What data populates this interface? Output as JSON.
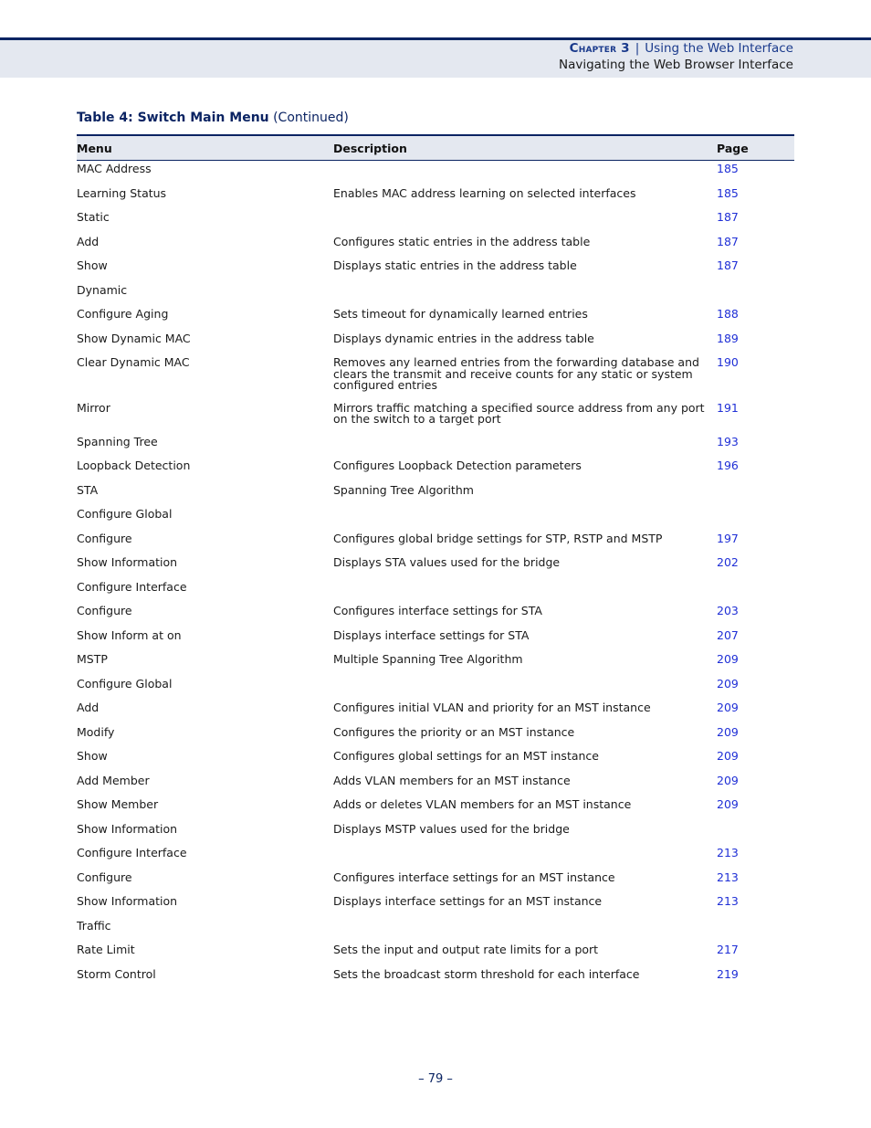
{
  "header": {
    "chapter_label": "Chapter 3",
    "separator": "|",
    "chapter_title": "Using the Web Interface",
    "section_title": "Navigating the Web Browser Interface"
  },
  "table": {
    "caption_bold": "Table 4: Switch Main Menu",
    "caption_suffix": "(Continued)",
    "columns": [
      "Menu",
      "Description",
      "Page"
    ],
    "rows": [
      {
        "level": 0,
        "menu": "MAC Address",
        "description": "",
        "page": "185"
      },
      {
        "level": 1,
        "menu": "Learning Status",
        "description": "Enables MAC address learning on selected interfaces",
        "page": "185"
      },
      {
        "level": 1,
        "menu": "Static",
        "description": "",
        "page": "187"
      },
      {
        "level": 2,
        "menu": "Add",
        "description": "Configures static entries in the address table",
        "page": "187"
      },
      {
        "level": 2,
        "menu": "Show",
        "description": "Displays static entries in the address table",
        "page": "187"
      },
      {
        "level": 1,
        "menu": "Dynamic",
        "description": "",
        "page": ""
      },
      {
        "level": 2,
        "menu": "Configure Aging",
        "description": "Sets timeout for dynamically learned entries",
        "page": "188"
      },
      {
        "level": 2,
        "menu": "Show Dynamic MAC",
        "description": "Displays dynamic entries in the address table",
        "page": "189"
      },
      {
        "level": 2,
        "menu": "Clear Dynamic MAC",
        "description": "Removes any learned entries from the forwarding database and clears the transmit and receive counts for any static or system configured entries",
        "page": "190"
      },
      {
        "level": 1,
        "menu": "Mirror",
        "description": "Mirrors traffic matching a specified source address from any port on the switch to a target port",
        "page": "191"
      },
      {
        "level": 0,
        "menu": "Spanning Tree",
        "description": "",
        "page": "193"
      },
      {
        "level": 1,
        "menu": "Loopback Detection",
        "description": "Configures Loopback Detection parameters",
        "page": "196"
      },
      {
        "level": 1,
        "menu": "STA",
        "description": "Spanning Tree Algorithm",
        "page": ""
      },
      {
        "level": 2,
        "menu": "Configure Global",
        "description": "",
        "page": ""
      },
      {
        "level": 3,
        "menu": "Configure",
        "description": "Configures global bridge settings for STP, RSTP and MSTP",
        "page": "197"
      },
      {
        "level": 3,
        "menu": "Show Information",
        "description": "Displays STA values used for the bridge",
        "page": "202"
      },
      {
        "level": 2,
        "menu": "Configure Interface",
        "description": "",
        "page": ""
      },
      {
        "level": 3,
        "menu": "Configure",
        "description": "Configures interface settings for STA",
        "page": "203"
      },
      {
        "level": 3,
        "menu": "Show Inform at on",
        "description": "Displays interface settings for STA",
        "page": "207"
      },
      {
        "level": 1,
        "menu": "MSTP",
        "description": "Multiple Spanning Tree Algorithm",
        "page": "209"
      },
      {
        "level": 2,
        "menu": "Configure Global",
        "description": "",
        "page": "209"
      },
      {
        "level": 3,
        "menu": "Add",
        "description": "Configures initial VLAN and priority for an MST instance",
        "page": "209"
      },
      {
        "level": 3,
        "menu": "Modify",
        "description": "Configures the priority or an MST instance",
        "page": "209"
      },
      {
        "level": 3,
        "menu": "Show",
        "description": "Configures global settings for an MST instance",
        "page": "209"
      },
      {
        "level": 3,
        "menu": "Add Member",
        "description": "Adds VLAN members for an MST instance",
        "page": "209"
      },
      {
        "level": 3,
        "menu": "Show Member",
        "description": "Adds or deletes VLAN members for an MST instance",
        "page": "209"
      },
      {
        "level": 3,
        "menu": "Show Information",
        "description": "Displays MSTP values used for the bridge",
        "page": ""
      },
      {
        "level": 2,
        "menu": "Configure Interface",
        "description": "",
        "page": "213"
      },
      {
        "level": 3,
        "menu": "Configure",
        "description": "Configures interface settings for an MST instance",
        "page": "213"
      },
      {
        "level": 3,
        "menu": "Show Information",
        "description": "Displays interface settings for an MST instance",
        "page": "213"
      },
      {
        "level": 0,
        "menu": "Traffic",
        "description": "",
        "page": ""
      },
      {
        "level": 1,
        "menu": "Rate Limit",
        "description": "Sets the input and output rate limits for a port",
        "page": "217"
      },
      {
        "level": 1,
        "menu": "Storm Control",
        "description": "Sets the broadcast storm threshold for each interface",
        "page": "219"
      }
    ]
  },
  "footer": {
    "page_number": "–  79  –"
  },
  "colors": {
    "accent_navy": "#0b2463",
    "header_band": "#e4e8f0",
    "link_blue": "#1f2fd6"
  }
}
